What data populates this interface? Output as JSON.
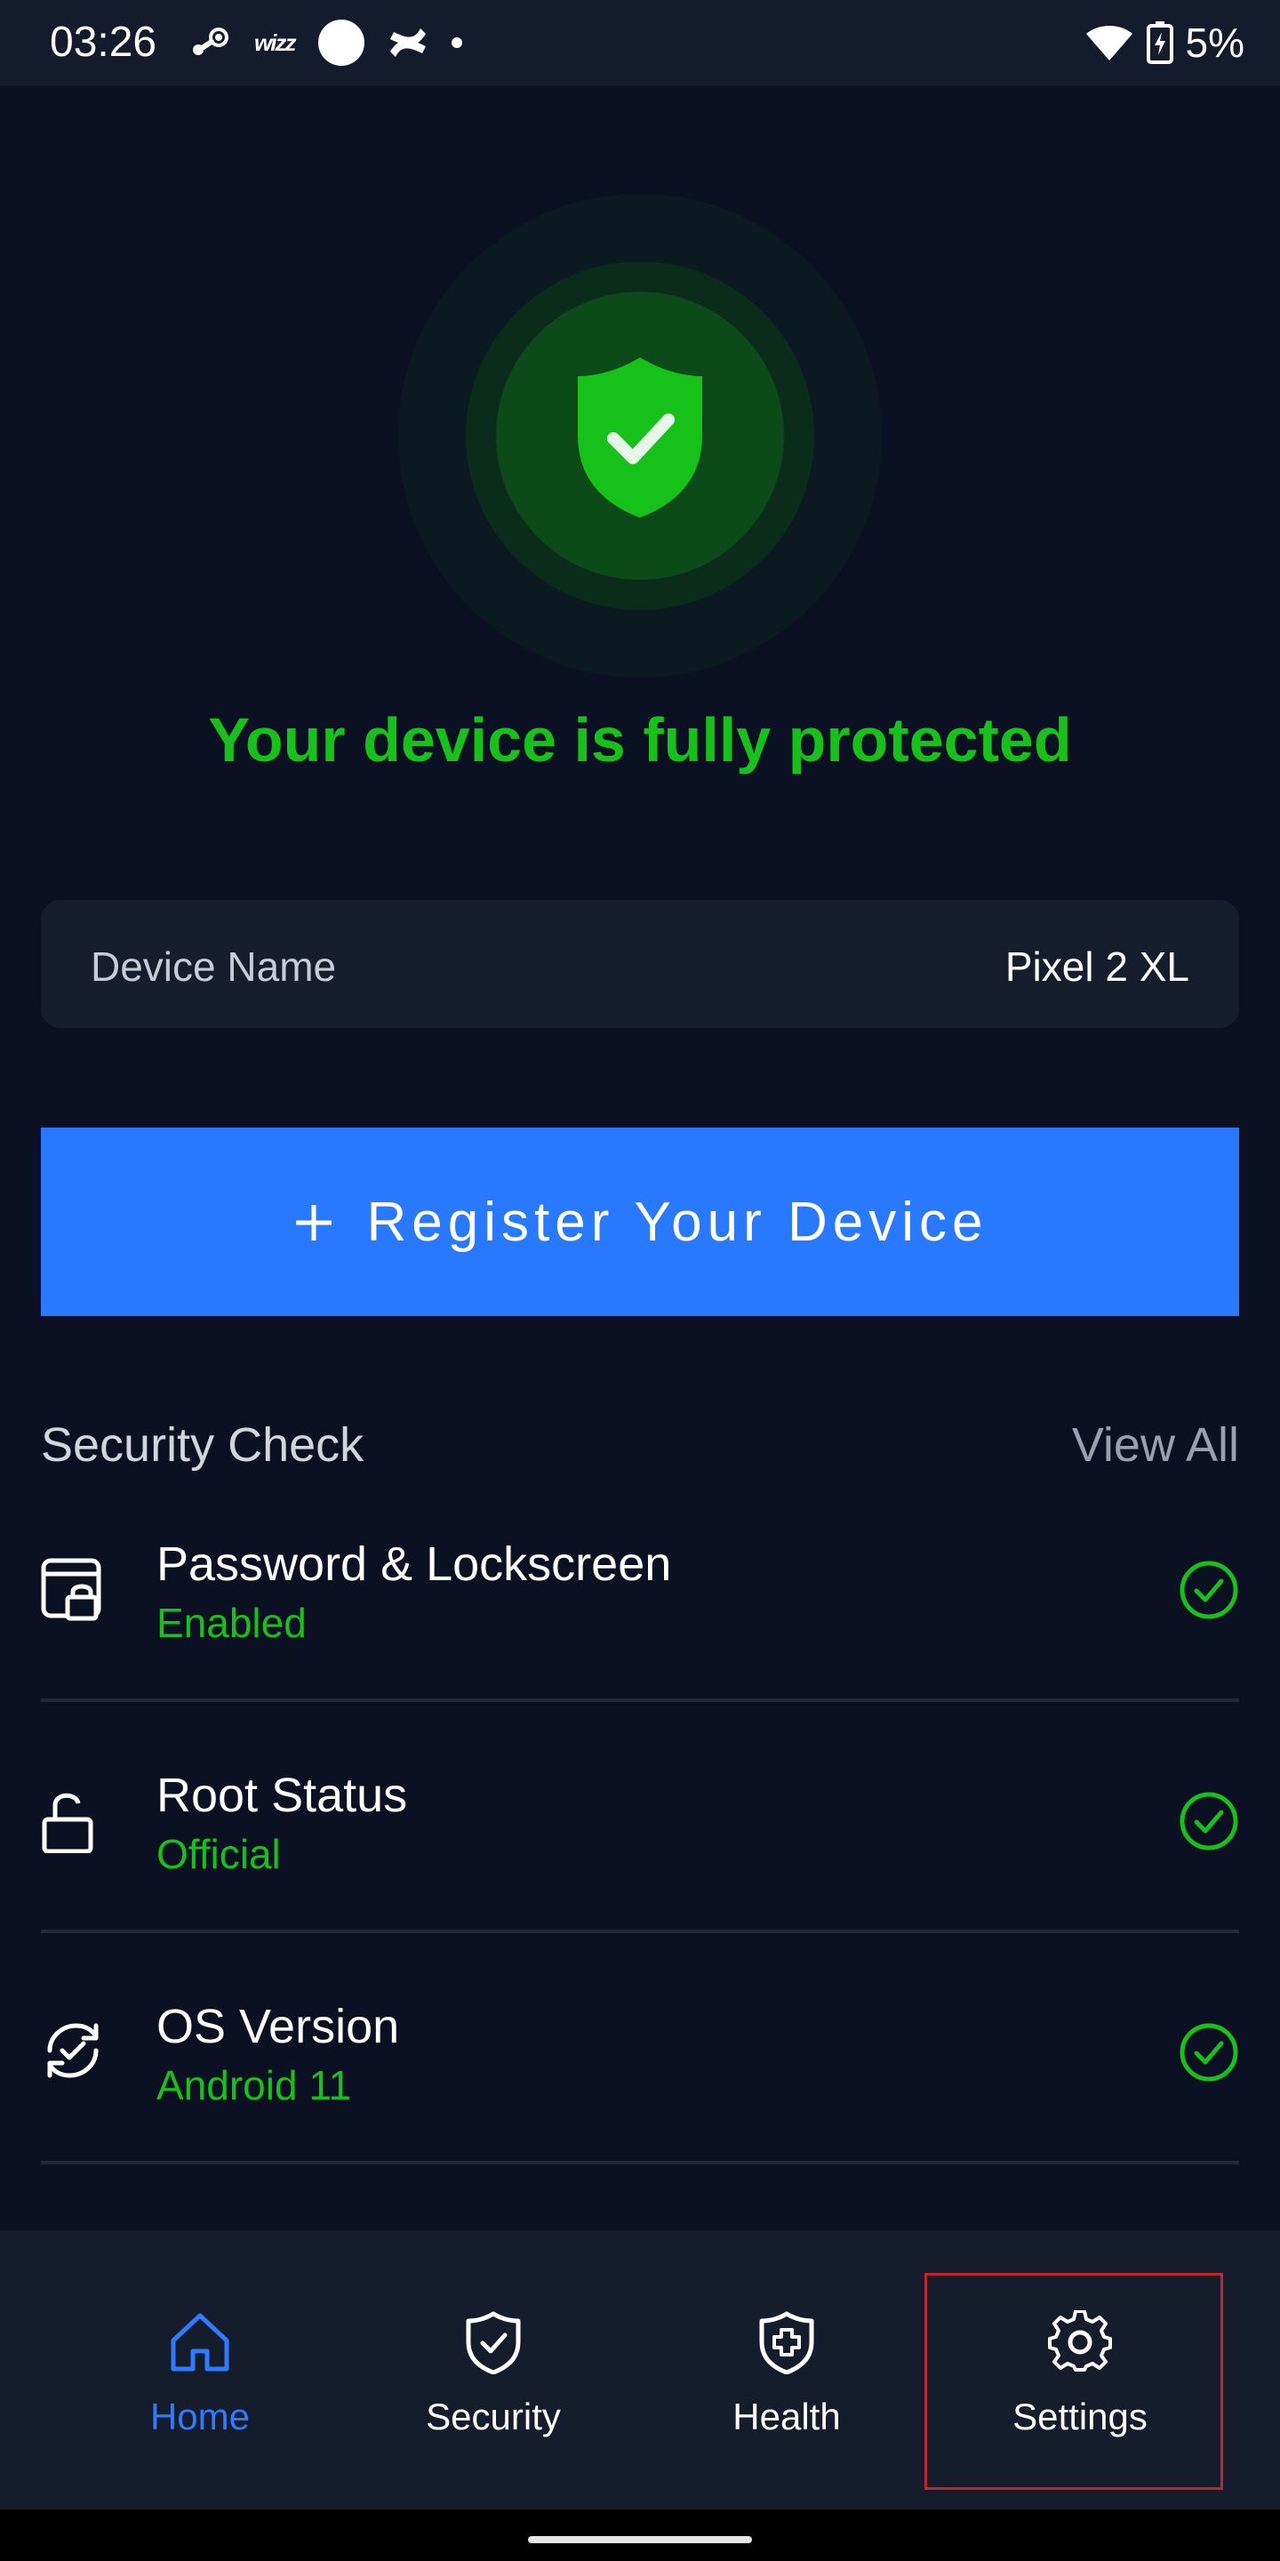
{
  "status_bar": {
    "time": "03:26",
    "app_icons": [
      "steam-icon",
      "wizz-icon",
      "circle-icon",
      "confluence-icon",
      "dot-icon"
    ],
    "wizz_text": "wizz",
    "right_icons": [
      "wifi-icon",
      "battery-charging-icon"
    ],
    "battery": "5%"
  },
  "hero": {
    "title": "Your device is fully protected",
    "accent_color": "#16c21a"
  },
  "device": {
    "label": "Device Name",
    "value": "Pixel 2 XL"
  },
  "register": {
    "label": "Register Your Device",
    "color": "#2979ff"
  },
  "security_check": {
    "title": "Security Check",
    "view_all": "View All",
    "items": [
      {
        "title": "Password & Lockscreen",
        "status": "Enabled",
        "icon": "lockscreen-icon"
      },
      {
        "title": "Root Status",
        "status": "Official",
        "icon": "unlock-icon"
      },
      {
        "title": "OS Version",
        "status": "Android 11",
        "icon": "sync-check-icon"
      }
    ]
  },
  "bottom_nav": {
    "items": [
      {
        "label": "Home",
        "icon": "home-icon",
        "active": true
      },
      {
        "label": "Security",
        "icon": "shield-check-icon",
        "active": false
      },
      {
        "label": "Health",
        "icon": "shield-plus-icon",
        "active": false
      },
      {
        "label": "Settings",
        "icon": "gear-icon",
        "active": false
      }
    ]
  }
}
